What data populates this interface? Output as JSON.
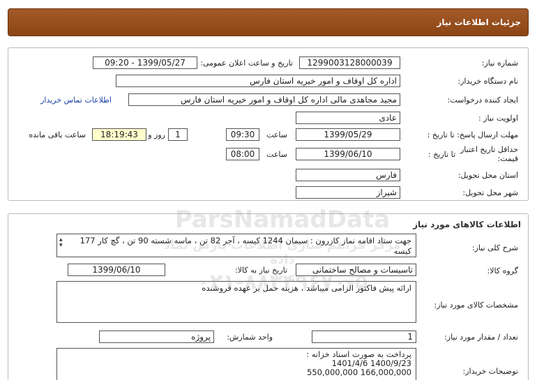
{
  "header": {
    "title": "جزئیات اطلاعات نیاز"
  },
  "details": {
    "need_number_label": "شماره نیاز:",
    "need_number": "1299003128000039",
    "announce_label": "تاریخ و ساعت اعلان عمومی:",
    "announce_value": "1399/05/27 - 09:20",
    "buyer_org_label": "نام دستگاه خریدار:",
    "buyer_org": "اداره کل اوقاف و امور خیریه استان فارس",
    "requester_label": "ایجاد کننده درخواست:",
    "requester": "مجید مجاهدی مالی اداره کل اوقاف و امور خیریه استان فارس",
    "contact_link": "اطلاعات تماس خریدار",
    "priority_label": "اولویت نیاز :",
    "priority": "عادی",
    "reply_deadline_label": "مهلت ارسال پاسخ:  تا تاریخ :",
    "reply_date": "1399/05/29",
    "time_label": "ساعت",
    "reply_time": "09:30",
    "days_value": "1",
    "days_label": "روز و",
    "remaining_time": "18:19:43",
    "remaining_label": "ساعت باقی مانده",
    "price_validity_label_1": "حداقل تاریخ اعتبار",
    "price_validity_label_2": "قیمت:",
    "until_date_label": "تا تاریخ :",
    "validity_date": "1399/06/10",
    "validity_time_label": "ساعت",
    "validity_time": "08:00",
    "province_label": "استان محل تحویل:",
    "province": "فارس",
    "city_label": "شهر محل تحویل:",
    "city": "شیراز"
  },
  "goods": {
    "title": "اطلاعات کالاهای مورد نیاز",
    "description_label": "شرح کلی نیاز:",
    "description": "جهت ستاد اقامه نماز کازرون : سیمان 1244 کیسه ، آجر 82 تن ، ماسه شسته 90 تن ، گچ کار 177 کیسه",
    "group_label": "گروه کالا:",
    "group": "تاسیسات و مصالح ساختمانی",
    "need_date_label": "تاریخ نیاز به کالا:",
    "need_date": "1399/06/10",
    "specs_label": "مشخصات کالای مورد نیاز:",
    "specs": "ارائه پیش فاکتور الزامی میباشد ، هزینه حمل بر عهده فروشنده",
    "quantity_label": "تعداد / مقدار مورد نیاز:",
    "quantity": "1",
    "unit_label": "واحد شمارش:",
    "unit": "پروژه",
    "buyer_notes_label": "توضیحات خریدار:",
    "buyer_notes_line1": "پرداخت به صورت اسناد خزانه :",
    "buyer_notes_line2": "1401/4/6          1400/9/23",
    "buyer_notes_line3": "550,000,000    166,000,000"
  },
  "watermark": {
    "line1": "ParsNamadData",
    "line2": "مرکز فراهم سازی اطلاعات پارس نماد داده",
    "line3": "۰۲۱-۸۸۳۴۹۶۷۰-۵"
  },
  "colors": {
    "header_bg": "#8b4513",
    "link": "#1a3fa8",
    "remaining_bg": "#ffffcc"
  }
}
